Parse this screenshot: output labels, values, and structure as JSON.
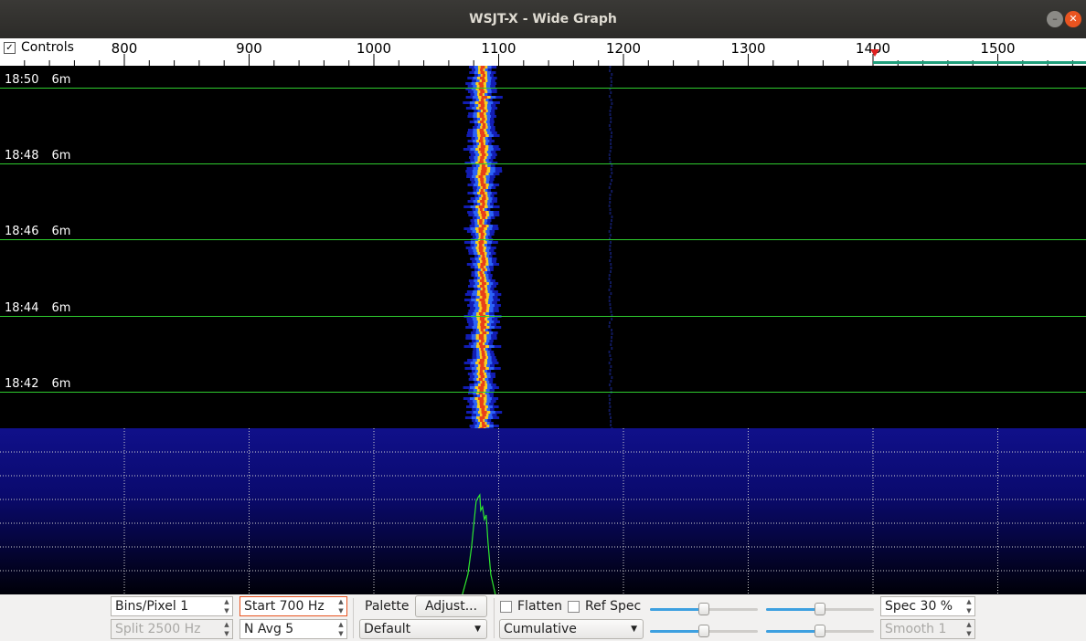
{
  "window": {
    "title": "WSJT-X - Wide Graph",
    "minimize_icon": "minimize-icon",
    "close_icon": "close-icon"
  },
  "ruler": {
    "controls_label": "Controls",
    "controls_checked": true,
    "freq_labels": [
      "800",
      "900",
      "1000",
      "1100",
      "1200",
      "1300",
      "1400",
      "1500"
    ]
  },
  "waterfall": {
    "rows": [
      {
        "time": "18:50",
        "band": "6m"
      },
      {
        "time": "18:48",
        "band": "6m"
      },
      {
        "time": "18:46",
        "band": "6m"
      },
      {
        "time": "18:44",
        "band": "6m"
      },
      {
        "time": "18:42",
        "band": "6m"
      }
    ],
    "signal_freq_hz": 1090
  },
  "controls": {
    "bins_pixel": "Bins/Pixel  1",
    "split": "Split  2500  Hz",
    "start": "Start 700 Hz",
    "navg": "N Avg 5",
    "palette_label": "Palette",
    "adjust_button": "Adjust...",
    "palette_value": "Default",
    "flatten_label": "Flatten",
    "refspec_label": "Ref Spec",
    "spectrum_mode": "Cumulative",
    "spec_pct": "Spec 30 %",
    "smooth": "Smooth  1"
  },
  "colors": {
    "grid_line": "#2ecc2e",
    "accent": "#e95420",
    "slider_fill": "#3da0e0"
  }
}
